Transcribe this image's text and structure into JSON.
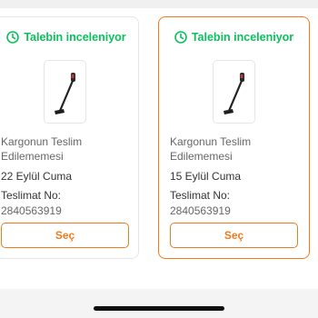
{
  "colors": {
    "accent": "#f27a1a",
    "status_green": "#0bc15c",
    "border": "#e6e6e6"
  },
  "cards": [
    {
      "status_icon": "clock-icon",
      "status": "Talebin inceleniyor",
      "product_icon": "stick-vacuum-image",
      "reason": "Kargonun Teslim Edilememesi",
      "date": "22 Eylül Cuma",
      "delivery_label": "Teslimat No:",
      "delivery_no": "2840563919",
      "button": "Seç",
      "selected": false
    },
    {
      "status_icon": "clock-icon",
      "status": "Talebin inceleniyor",
      "product_icon": "stick-vacuum-image",
      "reason": "Kargonun Teslim Edilememesi",
      "date": "15 Eylül Cuma",
      "delivery_label": "Teslimat No:",
      "delivery_no": "2840563919",
      "button": "Seç",
      "selected": true
    }
  ]
}
